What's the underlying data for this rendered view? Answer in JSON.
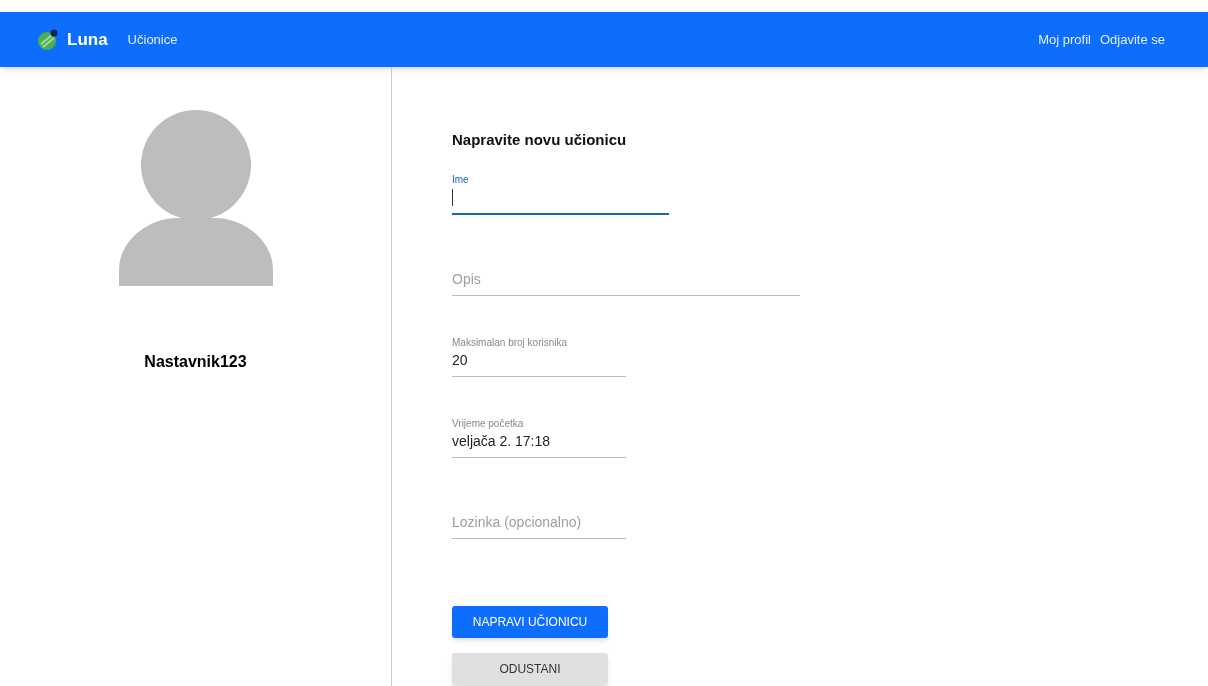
{
  "navbar": {
    "brand": "Luna",
    "links": [
      "Učionice"
    ],
    "right_links": [
      "Moj profil",
      "Odjavite se"
    ]
  },
  "profile": {
    "username": "Nastavnik123"
  },
  "form": {
    "title": "Napravite novu učionicu",
    "fields": [
      {
        "kind": "labeled",
        "label": "Ime",
        "focused": true
      },
      {
        "kind": "placeholder",
        "placeholder": "Opis",
        "focused": false
      },
      {
        "kind": "labeled",
        "label": "Maksimalan broj korisnika",
        "value": "20",
        "focused": false
      },
      {
        "kind": "labeled",
        "label": "Vrijeme početka",
        "value": "veljača 2. 17:18",
        "focused": false
      },
      {
        "kind": "placeholder",
        "placeholder": "Lozinka (opcionalno)",
        "focused": false
      }
    ],
    "buttons": [
      {
        "label": "NAPRAVI UČIONICU",
        "kind": "primary"
      },
      {
        "label": "ODUSTANI",
        "kind": "secondary"
      }
    ]
  }
}
